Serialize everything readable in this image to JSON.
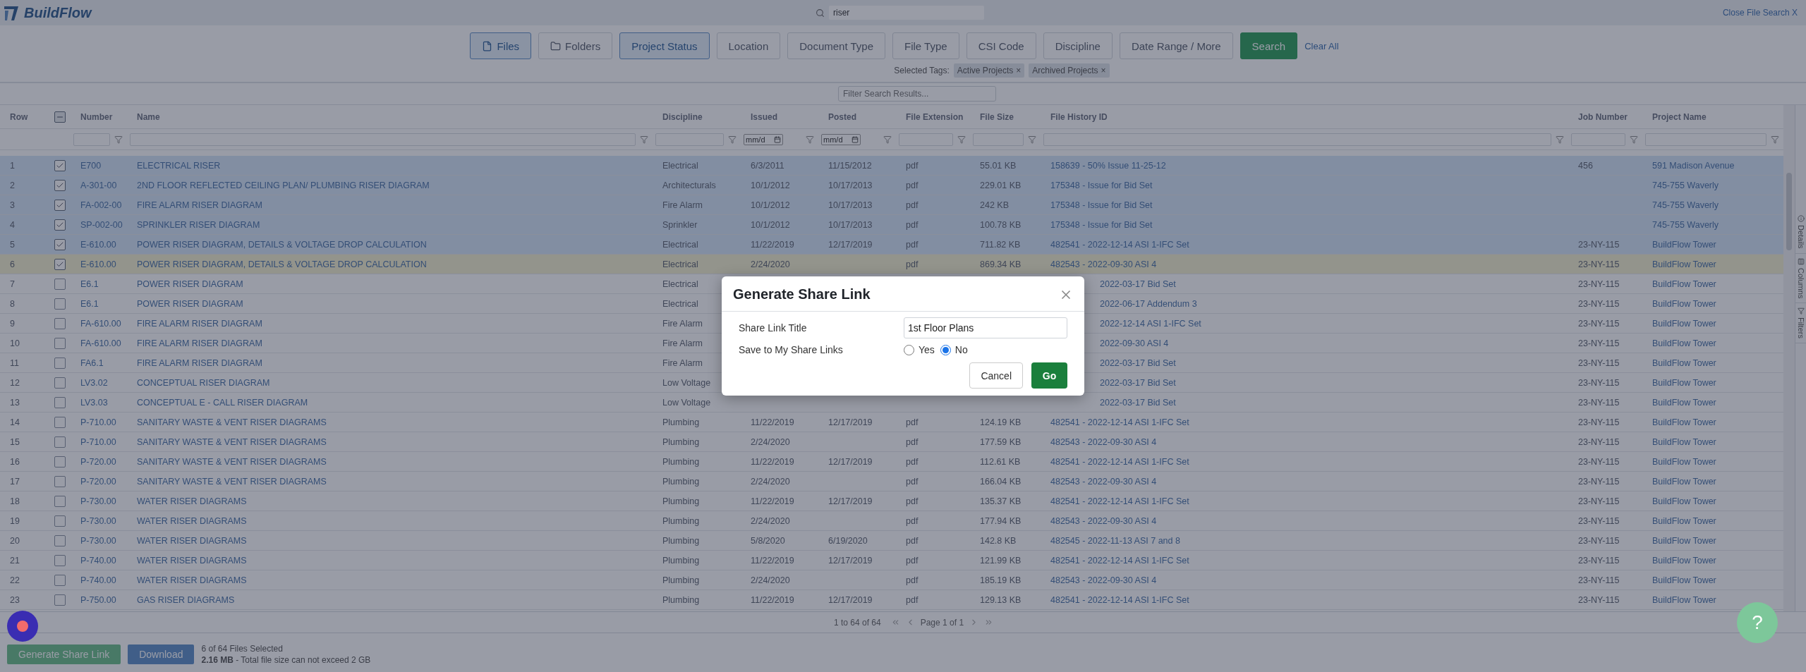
{
  "header": {
    "logo": "BuildFlow",
    "search": {
      "value": "riser"
    },
    "close_link": "Close File Search X"
  },
  "filter_buttons": [
    {
      "label": "Files",
      "kind": "file",
      "selected": true
    },
    {
      "label": "Folders",
      "kind": "folder",
      "selected": false
    },
    {
      "label": "Project Status",
      "kind": "plain",
      "selected": true
    },
    {
      "label": "Location",
      "kind": "plain",
      "selected": false
    },
    {
      "label": "Document Type",
      "kind": "plain",
      "selected": false
    },
    {
      "label": "File Type",
      "kind": "plain",
      "selected": false
    },
    {
      "label": "CSI Code",
      "kind": "plain",
      "selected": false
    },
    {
      "label": "Discipline",
      "kind": "plain",
      "selected": false
    },
    {
      "label": "Date Range / More",
      "kind": "plain",
      "selected": false
    },
    {
      "label": "Search",
      "kind": "search",
      "selected": false
    }
  ],
  "clear_all": "Clear All",
  "selected_tags": {
    "label": "Selected Tags:",
    "tags": [
      {
        "label": "Active Projects",
        "remove": "×"
      },
      {
        "label": "Archived Projects",
        "remove": "×"
      }
    ]
  },
  "results_filter": {
    "placeholder": "Filter Search Results..."
  },
  "table": {
    "columns": [
      "Row",
      "Number",
      "Name",
      "Discipline",
      "Issued",
      "Posted",
      "File Extension",
      "File Size",
      "File History ID",
      "Job Number",
      "Project Name"
    ],
    "select_all": {
      "indeterminate": true
    },
    "filters": [
      {
        "kind": "none"
      },
      {
        "kind": "text"
      },
      {
        "kind": "text"
      },
      {
        "kind": "text"
      },
      {
        "kind": "date",
        "placeholder": "mm/d"
      },
      {
        "kind": "date",
        "placeholder": "mm/d"
      },
      {
        "kind": "text"
      },
      {
        "kind": "text"
      },
      {
        "kind": "text"
      },
      {
        "kind": "text"
      },
      {
        "kind": "text"
      }
    ],
    "rows": [
      {
        "row": "1",
        "checked": true,
        "focused": false,
        "history_cut": false,
        "number": "E700",
        "name": "ELECTRICAL RISER",
        "discipline": "Electrical",
        "issued": "6/3/2011",
        "posted": "11/15/2012",
        "extension": "pdf",
        "size": "55.01 KB",
        "history": "158639 - 50% Issue 11-25-12",
        "job": "456",
        "project": "591 Madison Avenue"
      },
      {
        "row": "2",
        "checked": true,
        "focused": false,
        "history_cut": false,
        "number": "A-301-00",
        "name": "2ND FLOOR REFLECTED CEILING PLAN/ PLUMBING RISER DIAGRAM",
        "discipline": "Architecturals",
        "issued": "10/1/2012",
        "posted": "10/17/2013",
        "extension": "pdf",
        "size": "229.01 KB",
        "history": "175348 - Issue for Bid Set",
        "project": "745-755 Waverly"
      },
      {
        "row": "3",
        "checked": true,
        "focused": false,
        "history_cut": false,
        "number": "FA-002-00",
        "name": "FIRE ALARM RISER DIAGRAM",
        "discipline": "Fire Alarm",
        "issued": "10/1/2012",
        "posted": "10/17/2013",
        "extension": "pdf",
        "size": "242 KB",
        "history": "175348 - Issue for Bid Set",
        "project": "745-755 Waverly"
      },
      {
        "row": "4",
        "checked": true,
        "focused": false,
        "history_cut": false,
        "number": "SP-002-00",
        "name": "SPRINKLER RISER DIAGRAM",
        "discipline": "Sprinkler",
        "issued": "10/1/2012",
        "posted": "10/17/2013",
        "extension": "pdf",
        "size": "100.78 KB",
        "history": "175348 - Issue for Bid Set",
        "project": "745-755 Waverly"
      },
      {
        "row": "5",
        "checked": true,
        "focused": false,
        "history_cut": false,
        "number": "E-610.00",
        "name": "POWER RISER DIAGRAM, DETAILS & VOLTAGE DROP CALCULATION",
        "discipline": "Electrical",
        "issued": "11/22/2019",
        "posted": "12/17/2019",
        "extension": "pdf",
        "size": "711.82 KB",
        "history": "482541 - 2022-12-14 ASI 1-IFC Set",
        "job": "23-NY-115",
        "project": "BuildFlow Tower"
      },
      {
        "row": "6",
        "checked": true,
        "focused": true,
        "history_cut": false,
        "number": "E-610.00",
        "name": "POWER RISER DIAGRAM, DETAILS & VOLTAGE DROP CALCULATION",
        "discipline": "Electrical",
        "issued": "2/24/2020",
        "extension": "pdf",
        "size": "869.34 KB",
        "history": "482543 - 2022-09-30 ASI 4",
        "job": "23-NY-115",
        "project": "BuildFlow Tower"
      },
      {
        "row": "7",
        "checked": false,
        "focused": false,
        "history_cut": true,
        "number": "E6.1",
        "name": "POWER RISER DIAGRAM",
        "discipline": "Electrical",
        "history": "2022-03-17 Bid Set",
        "job": "23-NY-115",
        "project": "BuildFlow Tower"
      },
      {
        "row": "8",
        "checked": false,
        "focused": false,
        "history_cut": true,
        "number": "E6.1",
        "name": "POWER RISER DIAGRAM",
        "discipline": "Electrical",
        "history": "2022-06-17 Addendum 3",
        "job": "23-NY-115",
        "project": "BuildFlow Tower"
      },
      {
        "row": "9",
        "checked": false,
        "focused": false,
        "history_cut": true,
        "number": "FA-610.00",
        "name": "FIRE ALARM RISER DIAGRAM",
        "discipline": "Fire Alarm",
        "history": "2022-12-14 ASI 1-IFC Set",
        "job": "23-NY-115",
        "project": "BuildFlow Tower"
      },
      {
        "row": "10",
        "checked": false,
        "focused": false,
        "history_cut": true,
        "number": "FA-610.00",
        "name": "FIRE ALARM RISER DIAGRAM",
        "discipline": "Fire Alarm",
        "history": "2022-09-30 ASI 4",
        "job": "23-NY-115",
        "project": "BuildFlow Tower"
      },
      {
        "row": "11",
        "checked": false,
        "focused": false,
        "history_cut": true,
        "number": "FA6.1",
        "name": "FIRE ALARM RISER DIAGRAM",
        "discipline": "Fire Alarm",
        "history": "2022-03-17 Bid Set",
        "job": "23-NY-115",
        "project": "BuildFlow Tower"
      },
      {
        "row": "12",
        "checked": false,
        "focused": false,
        "history_cut": true,
        "number": "LV3.02",
        "name": "CONCEPTUAL RISER DIAGRAM",
        "discipline": "Low Voltage",
        "history": "2022-03-17 Bid Set",
        "job": "23-NY-115",
        "project": "BuildFlow Tower"
      },
      {
        "row": "13",
        "checked": false,
        "focused": false,
        "history_cut": true,
        "number": "LV3.03",
        "name": "CONCEPTUAL E - CALL RISER DIAGRAM",
        "discipline": "Low Voltage",
        "history": "2022-03-17 Bid Set",
        "job": "23-NY-115",
        "project": "BuildFlow Tower"
      },
      {
        "row": "14",
        "checked": false,
        "focused": false,
        "history_cut": false,
        "number": "P-710.00",
        "name": "SANITARY WASTE & VENT RISER DIAGRAMS",
        "discipline": "Plumbing",
        "issued": "11/22/2019",
        "posted": "12/17/2019",
        "extension": "pdf",
        "size": "124.19 KB",
        "history": "482541 - 2022-12-14 ASI 1-IFC Set",
        "job": "23-NY-115",
        "project": "BuildFlow Tower"
      },
      {
        "row": "15",
        "checked": false,
        "focused": false,
        "history_cut": false,
        "number": "P-710.00",
        "name": "SANITARY WASTE & VENT RISER DIAGRAMS",
        "discipline": "Plumbing",
        "issued": "2/24/2020",
        "extension": "pdf",
        "size": "177.59 KB",
        "history": "482543 - 2022-09-30 ASI 4",
        "job": "23-NY-115",
        "project": "BuildFlow Tower"
      },
      {
        "row": "16",
        "checked": false,
        "focused": false,
        "history_cut": false,
        "number": "P-720.00",
        "name": "SANITARY WASTE & VENT RISER DIAGRAMS",
        "discipline": "Plumbing",
        "issued": "11/22/2019",
        "posted": "12/17/2019",
        "extension": "pdf",
        "size": "112.61 KB",
        "history": "482541 - 2022-12-14 ASI 1-IFC Set",
        "job": "23-NY-115",
        "project": "BuildFlow Tower"
      },
      {
        "row": "17",
        "checked": false,
        "focused": false,
        "history_cut": false,
        "number": "P-720.00",
        "name": "SANITARY WASTE & VENT RISER DIAGRAMS",
        "discipline": "Plumbing",
        "issued": "2/24/2020",
        "extension": "pdf",
        "size": "166.04 KB",
        "history": "482543 - 2022-09-30 ASI 4",
        "job": "23-NY-115",
        "project": "BuildFlow Tower"
      },
      {
        "row": "18",
        "checked": false,
        "focused": false,
        "history_cut": false,
        "number": "P-730.00",
        "name": "WATER RISER DIAGRAMS",
        "discipline": "Plumbing",
        "issued": "11/22/2019",
        "posted": "12/17/2019",
        "extension": "pdf",
        "size": "135.37 KB",
        "history": "482541 - 2022-12-14 ASI 1-IFC Set",
        "job": "23-NY-115",
        "project": "BuildFlow Tower"
      },
      {
        "row": "19",
        "checked": false,
        "focused": false,
        "history_cut": false,
        "number": "P-730.00",
        "name": "WATER RISER DIAGRAMS",
        "discipline": "Plumbing",
        "issued": "2/24/2020",
        "extension": "pdf",
        "size": "177.94 KB",
        "history": "482543 - 2022-09-30 ASI 4",
        "job": "23-NY-115",
        "project": "BuildFlow Tower"
      },
      {
        "row": "20",
        "checked": false,
        "focused": false,
        "history_cut": false,
        "number": "P-730.00",
        "name": "WATER RISER DIAGRAMS",
        "discipline": "Plumbing",
        "issued": "5/8/2020",
        "posted": "6/19/2020",
        "extension": "pdf",
        "size": "142.8 KB",
        "history": "482545 - 2022-11-13 ASI 7 and 8",
        "job": "23-NY-115",
        "project": "BuildFlow Tower"
      },
      {
        "row": "21",
        "checked": false,
        "focused": false,
        "history_cut": false,
        "number": "P-740.00",
        "name": "WATER RISER DIAGRAMS",
        "discipline": "Plumbing",
        "issued": "11/22/2019",
        "posted": "12/17/2019",
        "extension": "pdf",
        "size": "121.99 KB",
        "history": "482541 - 2022-12-14 ASI 1-IFC Set",
        "job": "23-NY-115",
        "project": "BuildFlow Tower"
      },
      {
        "row": "22",
        "checked": false,
        "focused": false,
        "history_cut": false,
        "number": "P-740.00",
        "name": "WATER RISER DIAGRAMS",
        "discipline": "Plumbing",
        "issued": "2/24/2020",
        "extension": "pdf",
        "size": "185.19 KB",
        "history": "482543 - 2022-09-30 ASI 4",
        "job": "23-NY-115",
        "project": "BuildFlow Tower"
      },
      {
        "row": "23",
        "checked": false,
        "focused": false,
        "history_cut": false,
        "number": "P-750.00",
        "name": "GAS RISER DIAGRAMS",
        "discipline": "Plumbing",
        "issued": "11/22/2019",
        "posted": "12/17/2019",
        "extension": "pdf",
        "size": "129.13 KB",
        "history": "482541 - 2022-12-14 ASI 1-IFC Set",
        "job": "23-NY-115",
        "project": "BuildFlow Tower"
      }
    ]
  },
  "side_tabs": [
    {
      "label": "Details",
      "kind": "details"
    },
    {
      "label": "Columns",
      "kind": "columns"
    },
    {
      "label": "Filters",
      "kind": "filters"
    }
  ],
  "pager": {
    "summary": "1 to 64 of 64",
    "page": "Page 1 of 1"
  },
  "footer": {
    "share_button": "Generate Share Link",
    "download_button": "Download",
    "selection": "6 of 64 Files Selected",
    "size_note": "**2.16 MB** - Total file size can not exceed 2 GB"
  },
  "help": "?",
  "modal": {
    "title": "Generate Share Link",
    "fields": [
      {
        "label": "Share Link Title",
        "value": "1st Floor Plans"
      }
    ],
    "save_label": "Save to My Share Links",
    "options": [
      {
        "label": "Yes",
        "selected": false
      },
      {
        "label": "No",
        "selected": true
      }
    ],
    "cancel": "Cancel",
    "go": "Go"
  }
}
